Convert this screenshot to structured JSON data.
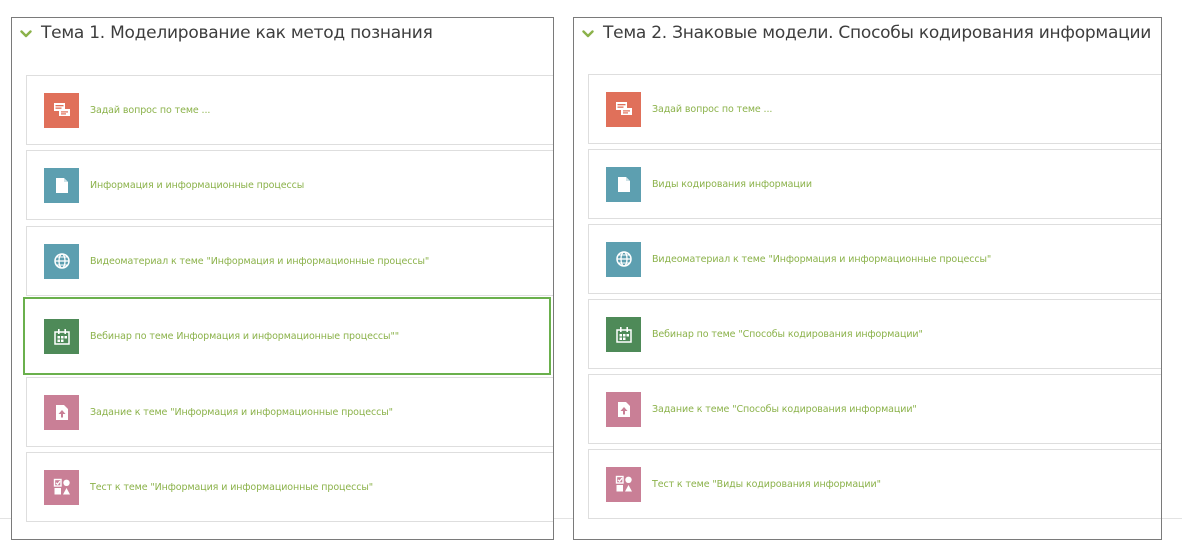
{
  "sections": [
    {
      "title": "Тема 1. Моделирование как метод познания",
      "activities": [
        {
          "type": "forum",
          "icon": "forum-icon",
          "label": "Задай вопрос по теме ..."
        },
        {
          "type": "resource",
          "icon": "file-icon",
          "label": "Информация и информационные процессы"
        },
        {
          "type": "url",
          "icon": "globe-icon",
          "label": "Видеоматериал к теме \"Информация и информационные процессы\""
        },
        {
          "type": "webinar",
          "icon": "calendar-icon",
          "label": "Вебинар по теме Информация и информационные процессы\"\""
        },
        {
          "type": "assign",
          "icon": "assignment-icon",
          "label": "Задание к теме \"Информация и информационные процессы\""
        },
        {
          "type": "quiz",
          "icon": "quiz-icon",
          "label": "Тест к теме \"Информация и информационные процессы\""
        }
      ]
    },
    {
      "title": "Тема 2. Знаковые модели. Способы кодирования информации",
      "activities": [
        {
          "type": "forum",
          "icon": "forum-icon",
          "label": "Задай вопрос по теме ..."
        },
        {
          "type": "resource",
          "icon": "file-icon",
          "label": "Виды кодирования информации"
        },
        {
          "type": "url",
          "icon": "globe-icon",
          "label": "Видеоматериал к теме \"Информация и информационные процессы\""
        },
        {
          "type": "webinar",
          "icon": "calendar-icon",
          "label": "Вебинар по теме \"Способы кодирования информации\""
        },
        {
          "type": "assign",
          "icon": "assignment-icon",
          "label": "Задание к теме \"Способы кодирования информации\""
        },
        {
          "type": "quiz",
          "icon": "quiz-icon",
          "label": "Тест к теме \"Виды кодирования информации\""
        }
      ]
    }
  ],
  "colors": {
    "link": "#8bb24a",
    "chevron": "#8bb24a",
    "highlight_border": "#6ab04c",
    "forum": "#e0705a",
    "resource": "#5d9fb0",
    "url": "#5d9fb0",
    "webinar": "#4e8a58",
    "assign": "#c97f96",
    "quiz": "#c97f96"
  }
}
